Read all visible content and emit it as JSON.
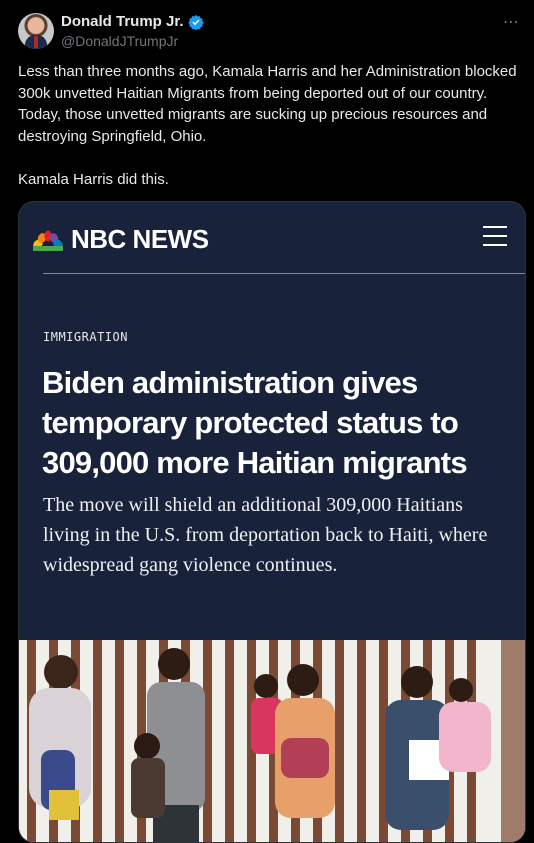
{
  "author": {
    "display_name": "Donald Trump Jr.",
    "handle": "@DonaldJTrumpJr"
  },
  "menu_icon": "more-dots-icon",
  "tweet": {
    "paragraph_1": "Less than three months ago, Kamala Harris and her Administration blocked 300k unvetted Haitian Migrants from being deported out of our country. Today, those unvetted migrants are sucking up precious resources and destroying Springfield, Ohio.",
    "paragraph_2": "Kamala Harris did this."
  },
  "media": {
    "brand": "NBC NEWS",
    "category": "IMMIGRATION",
    "headline": "Biden administration gives temporary protected status to 309,000 more Haitian migrants",
    "dek": "The move will shield an additional 309,000 Haitians living in the U.S. from deportation back to Haiti, where widespread gang violence continues."
  },
  "colors": {
    "background": "#000000",
    "verified": "#1d9bf0",
    "card_navy": "#18223b",
    "muted": "#71767b"
  }
}
